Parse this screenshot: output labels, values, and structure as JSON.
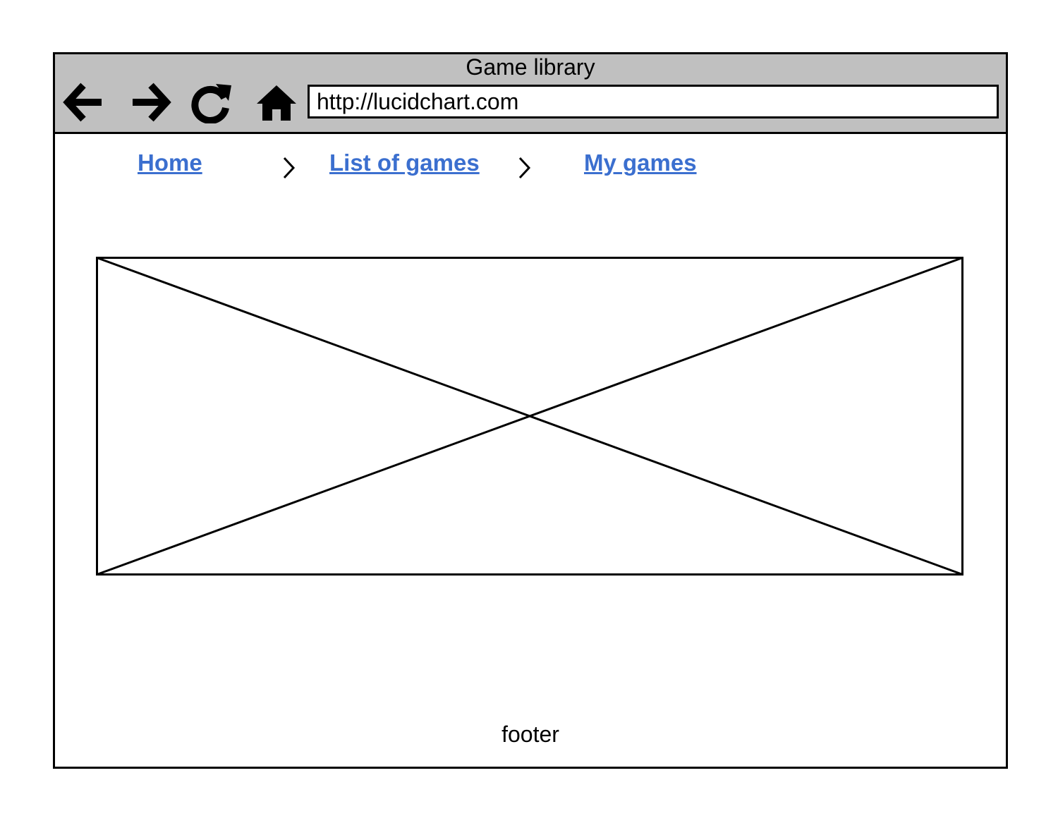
{
  "window": {
    "title": "Game library"
  },
  "toolbar": {
    "back_icon": "arrow-left-icon",
    "forward_icon": "arrow-right-icon",
    "reload_icon": "reload-icon",
    "home_icon": "home-icon",
    "address": "http://lucidchart.com"
  },
  "breadcrumb": {
    "items": [
      {
        "label": "Home"
      },
      {
        "label": "List of games"
      },
      {
        "label": "My games"
      }
    ],
    "separator_icon": "chevron-right-icon",
    "link_color": "#3b6fcf"
  },
  "content": {
    "image_placeholder_icon": "image-placeholder-icon"
  },
  "footer": {
    "text": "footer"
  },
  "colors": {
    "chrome_background": "#c0c0c0",
    "border": "#000000"
  }
}
